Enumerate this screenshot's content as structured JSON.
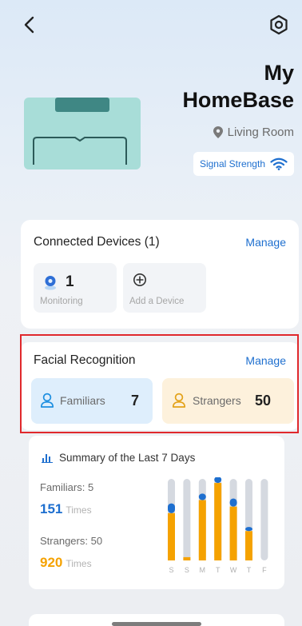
{
  "header": {
    "back_icon": "chevron-left-icon",
    "settings_icon": "gear-icon"
  },
  "device": {
    "title_line1": "My",
    "title_line2": "HomeBase",
    "location": "Living Room",
    "signal_label": "Signal Strength",
    "image_color": "#a8ddd8"
  },
  "connected": {
    "title": "Connected Devices (1)",
    "manage": "Manage",
    "tiles": [
      {
        "count": "1",
        "label": "Monitoring",
        "icon": "camera-icon"
      },
      {
        "count": "",
        "label": "Add a Device",
        "icon": "plus-circle-icon"
      }
    ]
  },
  "facial": {
    "title": "Facial Recognition",
    "manage": "Manage",
    "familiars": {
      "label": "Familiars",
      "value": "7"
    },
    "strangers": {
      "label": "Strangers",
      "value": "50"
    }
  },
  "summary": {
    "title": "Summary of the Last 7 Days",
    "familiars_label": "Familiars: 5",
    "familiars_times": "151",
    "strangers_label": "Strangers: 50",
    "strangers_times": "920",
    "times_unit": "Times"
  },
  "chart_data": {
    "type": "bar",
    "categories": [
      "S",
      "S",
      "M",
      "T",
      "W",
      "T",
      "F"
    ],
    "series": [
      {
        "name": "Familiars",
        "values": [
          0.12,
          0,
          0.08,
          0.08,
          0.1,
          0.05,
          0
        ]
      },
      {
        "name": "Strangers",
        "values": [
          0.58,
          0.04,
          0.74,
          0.95,
          0.66,
          0.36,
          0
        ]
      }
    ],
    "colors": {
      "familiars": "#1e6fcf",
      "strangers": "#f5a200",
      "track": "#d5d9e0"
    }
  },
  "colors": {
    "accent": "#1e6fcf",
    "stranger": "#f5a200",
    "highlight": "#e0282c"
  }
}
